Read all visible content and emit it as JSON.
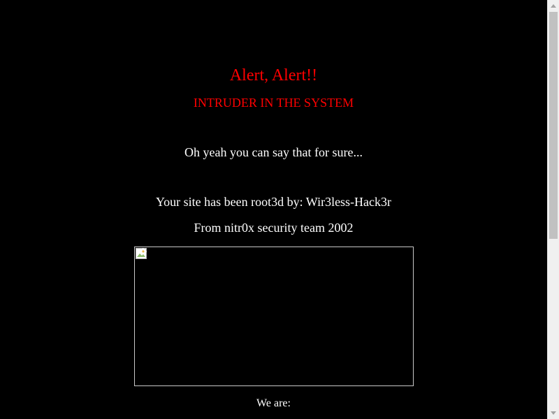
{
  "page": {
    "heading": "Alert, Alert!!",
    "subheading": "INTRUDER IN THE SYSTEM",
    "tagline": "Oh yeah you can say that for sure...",
    "owned_line": "Your site has been root3d by: Wir3less-Hack3r",
    "team_line": "From nitr0x security team 2002",
    "we_are": "We are:"
  },
  "colors": {
    "background": "#000000",
    "alert_red": "#ff0000",
    "text_white": "#ffffff"
  },
  "icons": {
    "image": "broken-image-icon",
    "scroll_up": "chevron-up-icon",
    "scroll_down": "chevron-down-icon"
  }
}
